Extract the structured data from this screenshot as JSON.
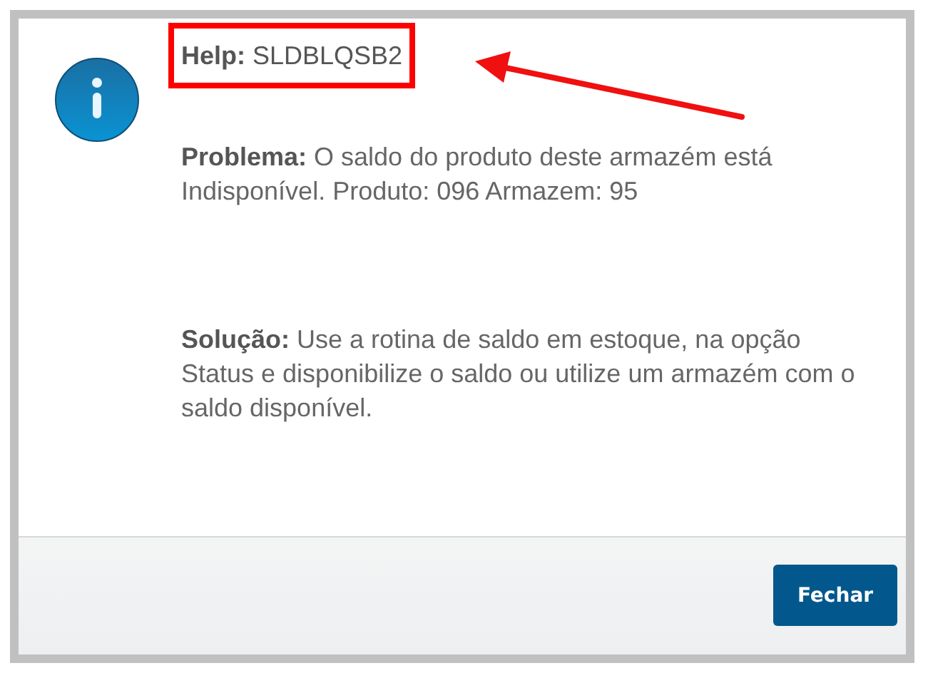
{
  "dialog": {
    "heading": "**Help:** SLDBLQSB2",
    "paragraphs": [
      {
        "kind": "problem",
        "text": "**Problema:** O saldo do produto deste armazém está Indisponível. Produto: 096 Armazem: 95"
      },
      {
        "kind": "solution",
        "text": "**Solução:** Use a rotina de saldo em estoque, na opção Status e disponibilize o saldo ou utilize um armazém com o saldo disponível."
      }
    ],
    "buttons": [
      "Fechar"
    ]
  }
}
